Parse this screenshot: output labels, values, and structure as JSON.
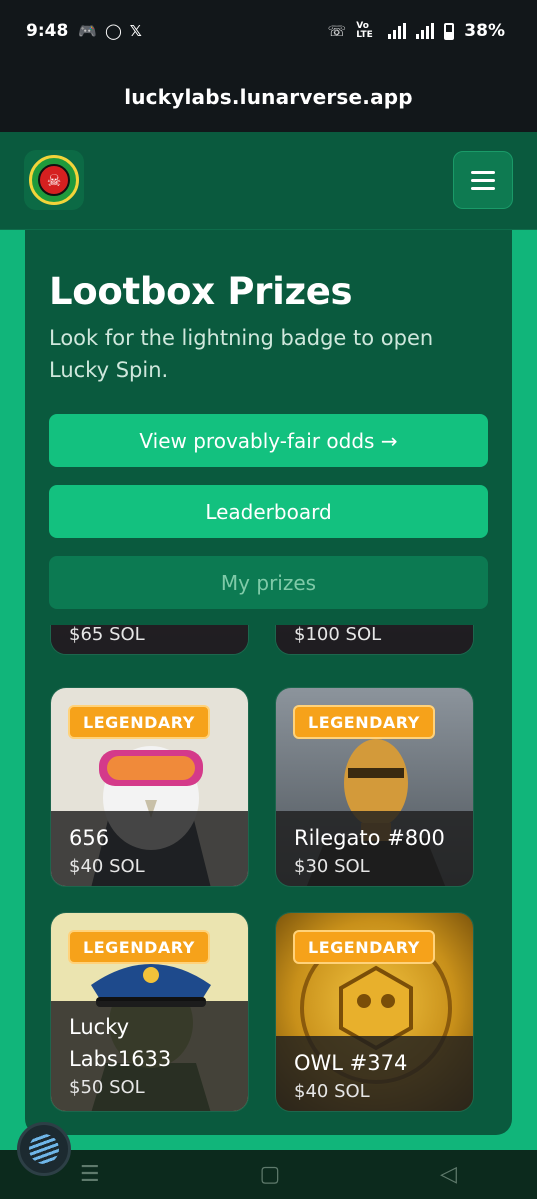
{
  "status_bar": {
    "time": "9:48",
    "battery": "38%",
    "network": "Vo LTE",
    "icons": [
      "discord-icon",
      "whatsapp-icon",
      "x-icon",
      "wifi-call-icon"
    ]
  },
  "browser": {
    "url": "luckylabs.lunarverse.app"
  },
  "header": {
    "logo_icon": "skull-logo-icon",
    "menu_icon": "hamburger-icon"
  },
  "main": {
    "title": "Lootbox Prizes",
    "subtitle": "Look for the lightning badge to open Lucky Spin.",
    "buttons": {
      "odds": "View provably-fair odds →",
      "leaderboard": "Leaderboard",
      "my_prizes": "My prizes"
    },
    "partial_prices": [
      "$65 SOL",
      "$100 SOL"
    ],
    "prizes": [
      {
        "badge": "LEGENDARY",
        "name": "656",
        "price": "$40 SOL"
      },
      {
        "badge": "LEGENDARY",
        "name": "Rilegato #800",
        "price": "$30 SOL"
      },
      {
        "badge": "LEGENDARY",
        "name": "Lucky Labs1633",
        "price": "$50 SOL"
      },
      {
        "badge": "LEGENDARY",
        "name": "OWL #374",
        "price": "$40 SOL"
      }
    ]
  },
  "colors": {
    "brand_green": "#13c17f",
    "card_green": "#0a5a3e",
    "badge_orange": "#f6a21a"
  },
  "nav": {
    "recents_icon": "recents-icon",
    "home_icon": "home-icon",
    "back_icon": "back-icon"
  }
}
